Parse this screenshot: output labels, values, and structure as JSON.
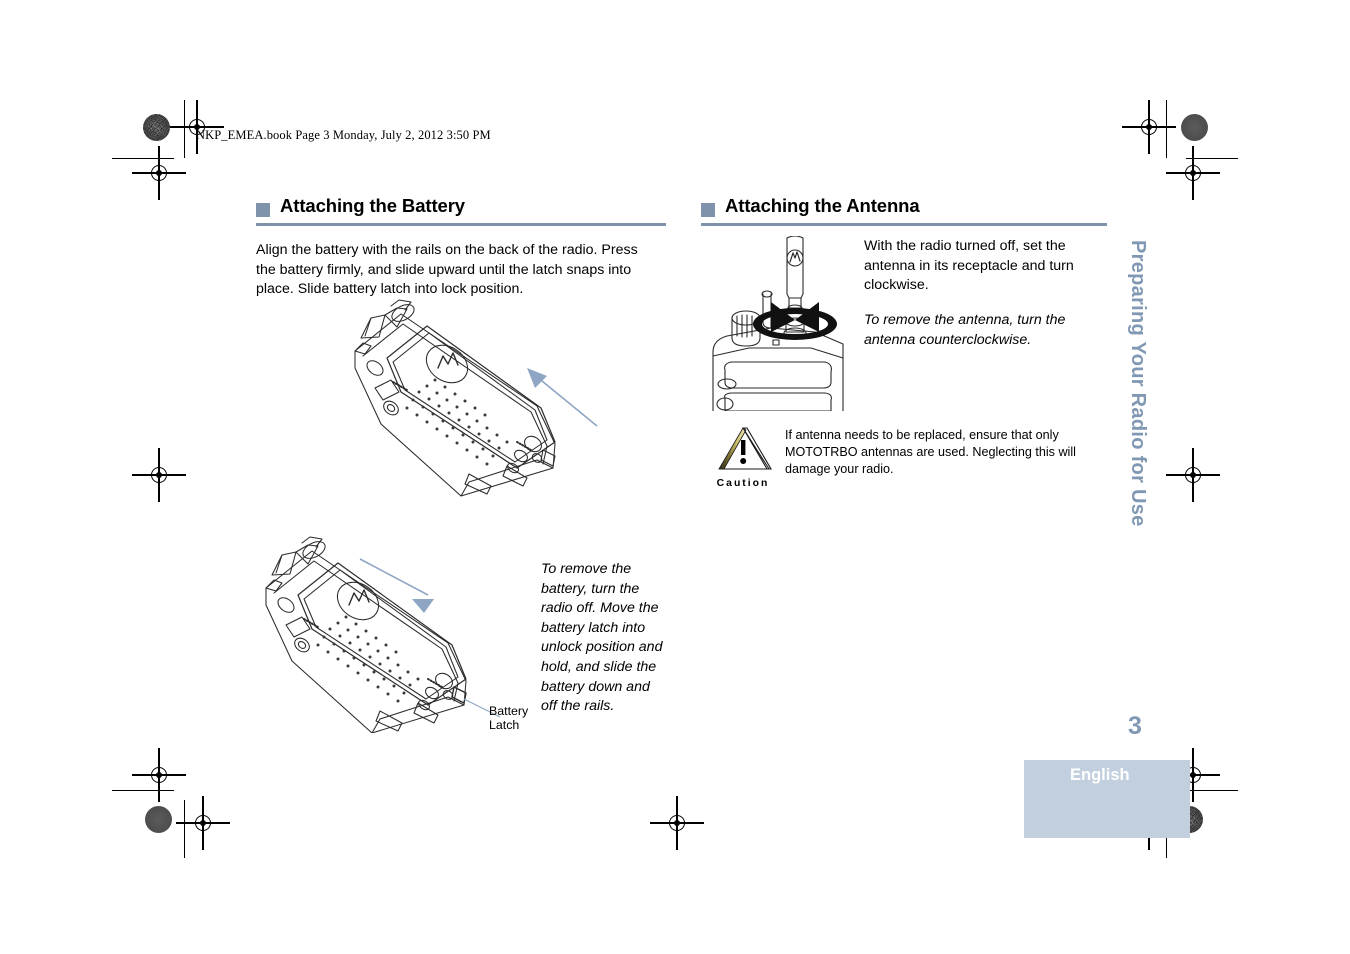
{
  "document": {
    "slug": "NKP_EMEA.book  Page 3  Monday, July 2, 2012  3:50 PM",
    "page_number": "3",
    "language": "English",
    "side_tab": "Preparing Your Radio for Use"
  },
  "colors": {
    "accent_slate": "#7f93ab",
    "side_tab_text": "#8098b4",
    "lang_block_bg": "#c2cfde",
    "lang_text": "#ffffff",
    "arrow_blue": "#8ea6c4"
  },
  "left_column": {
    "heading": "Attaching the Battery",
    "paragraph": "Align the battery with the rails on the back of the radio. Press the battery firmly, and slide upward until the latch snaps into place. Slide battery latch into lock position.",
    "remove_note": "To remove the battery, turn the radio off. Move the battery latch into unlock position and hold, and slide the battery down and off the rails.",
    "callout": "Battery\nLatch",
    "callout_line1": "Battery",
    "callout_line2": "Latch",
    "figure_top": "radio-battery-attach-illustration",
    "figure_bottom": "radio-battery-remove-illustration"
  },
  "right_column": {
    "heading": "Attaching the Antenna",
    "paragraph": "With the radio turned off, set the antenna in its receptacle and turn clockwise.",
    "remove_note": "To remove the antenna, turn the antenna counterclockwise.",
    "figure": "radio-antenna-attach-illustration",
    "caution": {
      "label": "Caution",
      "text": "If antenna needs to be replaced, ensure that only MOTOTRBO antennas are used. Neglecting this will damage your radio.",
      "icon": "warning-triangle-icon"
    }
  }
}
